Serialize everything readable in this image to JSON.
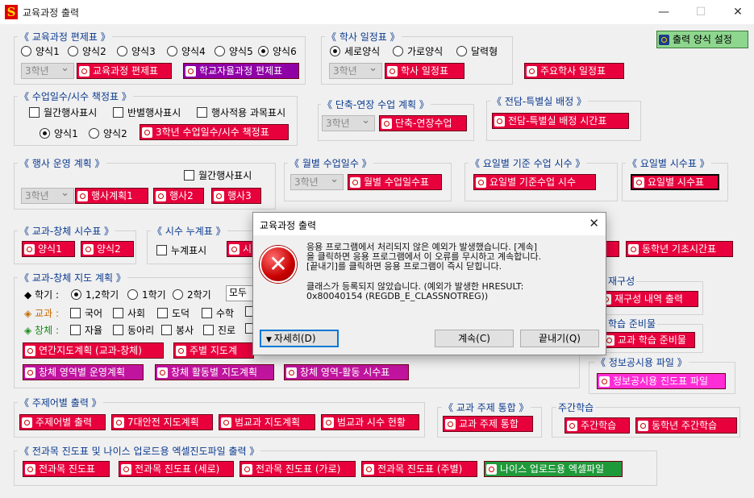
{
  "window": {
    "title": "교육과정 출력",
    "minimize": "—",
    "maximize": "☐",
    "close": "✕",
    "app_icon": "S"
  },
  "curriculum": {
    "title": "《 교육과정 편제표 》",
    "options": [
      "양식1",
      "양식2",
      "양식3",
      "양식4",
      "양식5",
      "양식6"
    ],
    "selected": "양식6",
    "grade": "3학년",
    "btn_curriculum": "교육과정 편제표",
    "btn_autonomous": "학교자율과정 편제표"
  },
  "schedule": {
    "title": "《 학사 일정표 》",
    "options": [
      "세로양식",
      "가로양식",
      "달력형"
    ],
    "selected": "세로양식",
    "grade": "3학년",
    "btn_schedule": "학사 일정표",
    "btn_major": "주요학사 일정표"
  },
  "output_setting": "출력 양식 설정",
  "days": {
    "title": "《 수업일수/시수 책정표 》",
    "chk_monthly": "월간행사표시",
    "chk_class": "반별행사표시",
    "chk_event_subject": "행사적용 과목표시",
    "radio1": "양식1",
    "radio2": "양식2",
    "btn": "3학년 수업일수/시수 책정표"
  },
  "short": {
    "title": "《 단축-연장 수업 계획 》",
    "grade": "3학년",
    "btn": "단축-연장수업"
  },
  "room": {
    "title": "《 전담-특별실 배정 》",
    "btn": "전담-특별실 배정 시간표"
  },
  "event": {
    "title": "《 행사 운영 계획 》",
    "chk_monthly": "월간행사표시",
    "grade": "3학년",
    "btn1": "행사계획1",
    "btn2": "행사2",
    "btn3": "행사3"
  },
  "monthly": {
    "title": "《 월별 수업일수 》",
    "grade": "3학년",
    "btn": "월별 수업일수표"
  },
  "weekday": {
    "title": "《 요일별 기준 수업 시수 》",
    "btn": "요일별 기준수업 시수"
  },
  "weekday_hours": {
    "title": "《 요일별 시수표 》",
    "btn": "요일별 시수표"
  },
  "subject_hours": {
    "title": "《 교과-창체 시수표 》",
    "btn1": "양식1",
    "btn2": "양식2"
  },
  "cumulative": {
    "title": "《 시수 누계표 》",
    "chk": "누계표시",
    "btn": "시"
  },
  "same_grade": {
    "btn": "동학년 기초시간표"
  },
  "guidance": {
    "title": "《 교과-창체 지도 계획 》",
    "term_label": "◆ 학기 :",
    "terms": [
      "1,2학기",
      "1학기",
      "2학기"
    ],
    "term_selected": "1,2학기",
    "all_btn": "모두",
    "subject_label": "◈ 교과 :",
    "subjects": [
      "국어",
      "사회",
      "도덕",
      "수학"
    ],
    "activity_label": "◈ 창체 :",
    "activities": [
      "자율",
      "동아리",
      "봉사",
      "진로"
    ],
    "btn_yearly": "연간지도계획 (교과-창체)",
    "btn_weekly": "주별 지도계",
    "btn_area": "창체 영역별 운영계획",
    "btn_activity": "창체 활동별 지도계획",
    "btn_area_hours": "창체 영역-활동 시수표"
  },
  "reorg": {
    "title": "재구성",
    "btn": "재구성 내역 출력"
  },
  "prep": {
    "title": "학습 준비물",
    "btn": "교과 학습 준비물"
  },
  "disclosure": {
    "title": "《 정보공시용 파일 》",
    "btn": "정보공시용 진도표 파일"
  },
  "theme": {
    "title": "《 주제어별 출력 》",
    "btn1": "주제어별 출력",
    "btn2": "7대안전 지도계획",
    "btn3": "범교과 지도계획",
    "btn4": "범교과 시수 현황"
  },
  "integration": {
    "title": "《 교과 주제 통합 》",
    "btn": "교과 주제 통합"
  },
  "weekly_learning": {
    "title": "주간학습",
    "btn1": "주간학습",
    "btn2": "동학년 주간학습"
  },
  "progress": {
    "title": "《 전과목 진도표 및 나이스 업로드용 엑셀진도파일 출력 》",
    "btn1": "전과목 진도표",
    "btn2": "전과목 진도표 (세로)",
    "btn3": "전과목 진도표 (가로)",
    "btn4": "전과목 진도표 (주별)",
    "btn5": "나이스 업로드용 엑셀파일"
  },
  "dialog": {
    "title": "교육과정 출력",
    "close": "✕",
    "error_icon": "✕",
    "line1": "응용 프로그램에서 처리되지 않은 예외가 발생했습니다. [계속]",
    "line2": "을 클릭하면 응용 프로그램에서 이 오류를 무시하고 계속합니다.",
    "line3": "[끝내기]를 클릭하면 응용 프로그램이 즉시 닫힙니다.",
    "line4": "클래스가 등록되지 않았습니다. (예외가 발생한 HRESULT:",
    "line5": "0x80040154 (REGDB_E_CLASSNOTREG))",
    "details": "자세히(D)",
    "continue": "계속(C)",
    "quit": "끝내기(Q)"
  }
}
